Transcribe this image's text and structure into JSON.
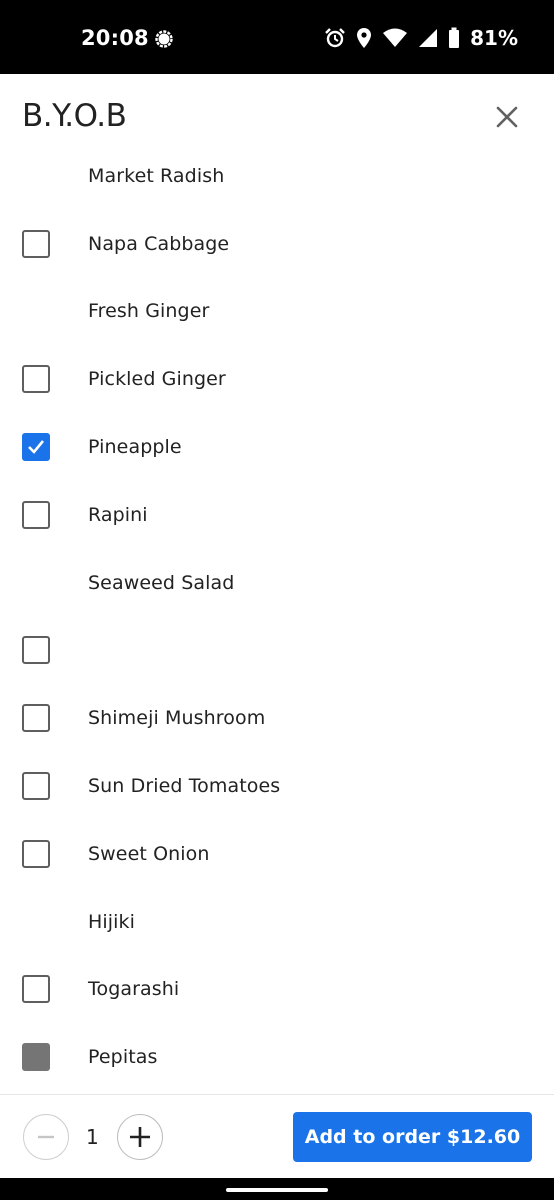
{
  "status_bar": {
    "time": "20:08",
    "battery": "81%",
    "icons": [
      "chat-bubble-icon",
      "alarm-icon",
      "location-icon",
      "wifi-icon",
      "signal-icon",
      "battery-icon"
    ]
  },
  "header": {
    "title": "B.Y.O.B",
    "close_icon": "close-icon"
  },
  "items": [
    {
      "label": "Market Radish",
      "checkbox": "none"
    },
    {
      "label": "Napa Cabbage",
      "checkbox": "unchecked"
    },
    {
      "label": "Fresh Ginger",
      "checkbox": "none"
    },
    {
      "label": "Pickled Ginger",
      "checkbox": "unchecked"
    },
    {
      "label": "Pineapple",
      "checkbox": "checked"
    },
    {
      "label": "Rapini",
      "checkbox": "unchecked"
    },
    {
      "label": "Seaweed Salad",
      "checkbox": "none"
    },
    {
      "label": "",
      "checkbox": "unchecked"
    },
    {
      "label": "Shimeji Mushroom",
      "checkbox": "unchecked"
    },
    {
      "label": "Sun Dried Tomatoes",
      "checkbox": "unchecked"
    },
    {
      "label": "Sweet Onion",
      "checkbox": "unchecked"
    },
    {
      "label": "Hijiki",
      "checkbox": "none"
    },
    {
      "label": "Togarashi",
      "checkbox": "unchecked"
    },
    {
      "label": "Pepitas",
      "checkbox": "disabled"
    }
  ],
  "footer": {
    "quantity": "1",
    "add_button_label": "Add to order $12.60"
  },
  "colors": {
    "accent": "#1a73e8",
    "checkbox_border": "#5f5f5f",
    "disabled_fill": "#757575"
  }
}
